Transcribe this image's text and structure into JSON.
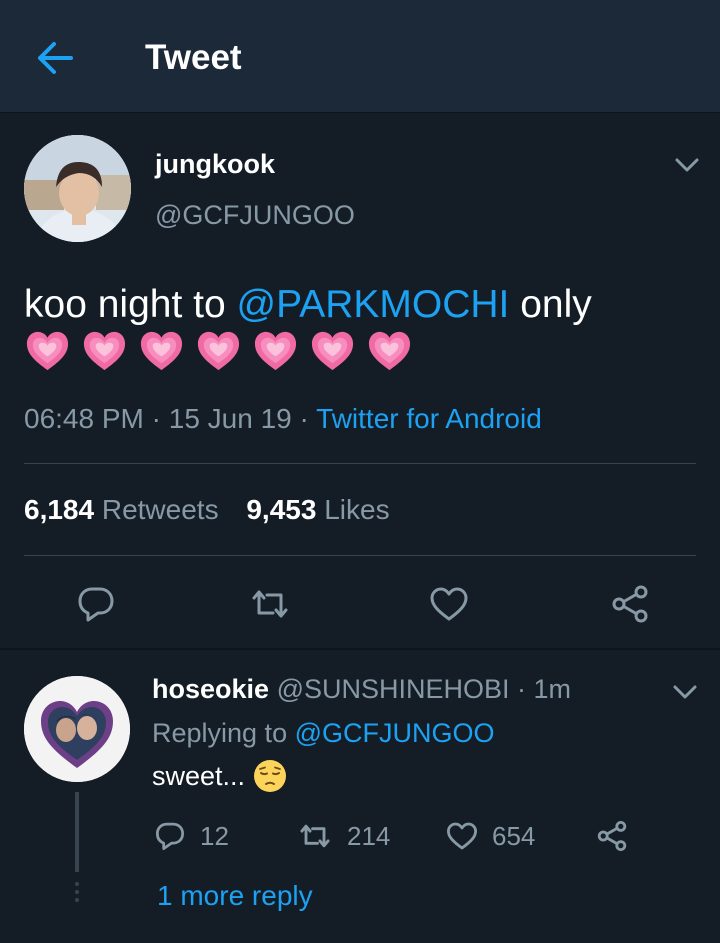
{
  "header": {
    "title": "Tweet"
  },
  "tweet": {
    "display_name": "jungkook",
    "handle": "@GCFJUNGOO",
    "text_before": "koo night to ",
    "mention": "@PARKMOCHI",
    "text_after": " only",
    "emoji": "growing-heart",
    "emoji_count": 7,
    "time": "06:48 PM",
    "date": "15 Jun 19",
    "app": "Twitter for Android",
    "retweets_count": "6,184",
    "retweets_label": "Retweets",
    "likes_count": "9,453",
    "likes_label": "Likes"
  },
  "reply": {
    "display_name": "hoseokie",
    "handle": "@SUNSHINEHOBI",
    "time": "1m",
    "replying_prefix": "Replying to ",
    "replying_to": "@GCFJUNGOO",
    "text": "sweet...",
    "emoji": "pensive-face",
    "reply_count": "12",
    "retweet_count": "214",
    "like_count": "654",
    "more_replies": "1 more reply"
  },
  "colors": {
    "background": "#141d26",
    "header": "#1c2938",
    "accent": "#1da1f2",
    "secondary_text": "#8899a6",
    "divider": "#38444d"
  }
}
